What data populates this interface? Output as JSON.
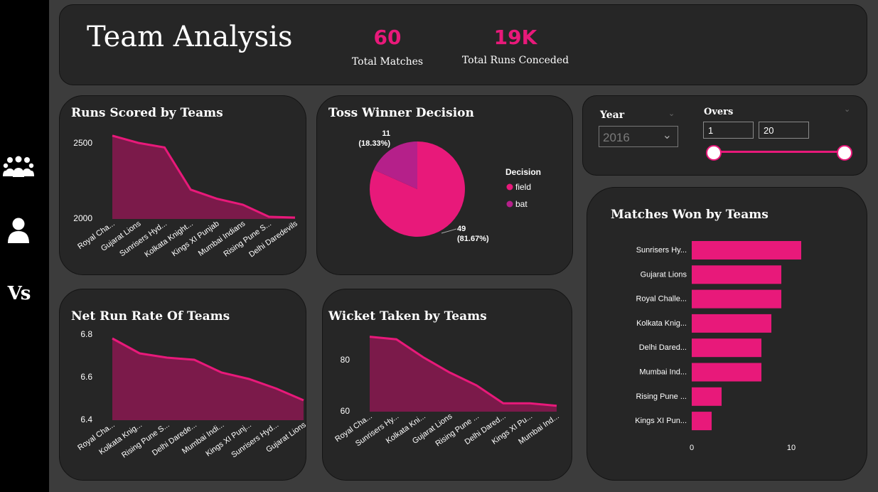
{
  "colors": {
    "accent": "#e8197a",
    "area_fill": "#7b1a4a",
    "bat_slice": "#b5208a",
    "card_bg": "#262626"
  },
  "sidebar": {
    "items": [
      {
        "icon": "team-group-icon",
        "label": ""
      },
      {
        "icon": "player-icon",
        "label": ""
      },
      {
        "icon": "versus-icon",
        "label": "Vs"
      }
    ]
  },
  "header": {
    "title": "Team Analysis",
    "kpis": [
      {
        "value": "60",
        "label": "Total Matches"
      },
      {
        "value": "19K",
        "label": "Total Runs Conceded"
      }
    ]
  },
  "filters": {
    "year": {
      "label": "Year",
      "selected": "2016"
    },
    "overs": {
      "label": "Overs",
      "min": "1",
      "max": "20",
      "range_start_fraction": 0,
      "range_end_fraction": 1
    }
  },
  "chart_data": [
    {
      "id": "runs",
      "type": "area",
      "title": "Runs Scored by Teams",
      "categories": [
        "Royal Cha...",
        "Gujarat Lions",
        "Sunrisers Hyd...",
        "Kolkata Knight...",
        "Kings XI Punjab",
        "Mumbai Indians",
        "Rising Pune S...",
        "Delhi Daredevils"
      ],
      "values": [
        2548,
        2500,
        2470,
        2190,
        2130,
        2090,
        2010,
        2005
      ],
      "ylim": [
        2000,
        2500
      ],
      "yticks": [
        "2000",
        "2500"
      ],
      "grid": false
    },
    {
      "id": "toss",
      "type": "pie",
      "title": "Toss Winner Decision",
      "legend_title": "Decision",
      "legend_position": "right",
      "slices": [
        {
          "name": "field",
          "value": 49,
          "label": "49",
          "pct": "(81.67%)"
        },
        {
          "name": "bat",
          "value": 11,
          "label": "11",
          "pct": "(18.33%)"
        }
      ]
    },
    {
      "id": "nrr",
      "type": "area",
      "title": "Net Run Rate Of Teams",
      "categories": [
        "Royal Cha...",
        "Kolkata Knig...",
        "Rising Pune S...",
        "Delhi Darede...",
        "Mumbai Indi...",
        "Kings XI Punj...",
        "Sunrisers Hyd...",
        "Gujarat Lions"
      ],
      "values": [
        6.78,
        6.71,
        6.69,
        6.68,
        6.62,
        6.59,
        6.545,
        6.49
      ],
      "ylim": [
        6.4,
        6.8
      ],
      "yticks": [
        "6.4",
        "6.6",
        "6.8"
      ],
      "grid": false
    },
    {
      "id": "wickets",
      "type": "area",
      "title": "Wicket Taken by Teams",
      "categories": [
        "Royal Cha...",
        "Sunrisers Hy...",
        "Kolkata Kni...",
        "Gujarat Lions",
        "Rising Pune ...",
        "Delhi Dared...",
        "Kings XI Pu...",
        "Mumbai Ind..."
      ],
      "values": [
        89,
        88,
        81,
        75,
        70,
        63,
        63,
        62
      ],
      "ylim": [
        60,
        80
      ],
      "yticks": [
        "60",
        "80"
      ],
      "grid": false
    },
    {
      "id": "won",
      "type": "bar",
      "orientation": "horizontal",
      "title": "Matches Won by Teams",
      "categories": [
        "Sunrisers Hy...",
        "Gujarat Lions",
        "Royal Challe...",
        "Kolkata Knig...",
        "Delhi Dared...",
        "Mumbai Ind...",
        "Rising Pune ...",
        "Kings XI Pun..."
      ],
      "values": [
        11,
        9,
        9,
        8,
        7,
        7,
        3,
        2
      ],
      "xlim": [
        0,
        11
      ],
      "xticks": [
        "0",
        "10"
      ],
      "grid": false
    }
  ]
}
